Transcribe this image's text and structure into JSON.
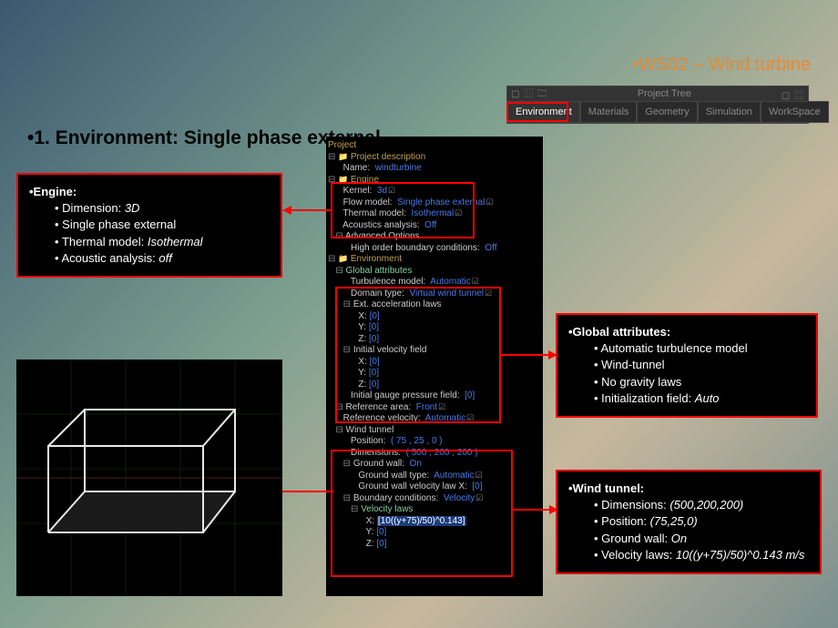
{
  "slide_title": "•WS02 – Wind turbine",
  "section_heading": "•1. Environment: Single phase external",
  "project_tree_panel": {
    "title": "Project Tree",
    "left_icons": "▢ ⿲ 🗀",
    "right_icons": "▢ ⿴",
    "tabs": [
      "Environment",
      "Materials",
      "Geometry",
      "Simulation",
      "WorkSpace"
    ],
    "active_tab": "Environment"
  },
  "tree": {
    "project": "Project",
    "project_desc": "Project description",
    "name_l": "Name:",
    "name_v": "windturbine",
    "engine": "Engine",
    "kernel_l": "Kernel:",
    "kernel_v": "3d",
    "flow_l": "Flow model:",
    "flow_v": "Single phase external",
    "thermal_l": "Thermal model:",
    "thermal_v": "Isothermal",
    "acou_l": "Acoustics analysis:",
    "acou_v": "Off",
    "adv": "Advanced Options",
    "hobc_l": "High order boundary conditions:",
    "hobc_v": "Off",
    "env": "Environment",
    "glob": "Global attributes",
    "turb_l": "Turbulence model:",
    "turb_v": "Automatic",
    "dom_l": "Domain type:",
    "dom_v": "Virtual wind tunnel",
    "extacc": "Ext. acceleration laws",
    "x_l": "X:",
    "x_v": "[0]",
    "y_l": "Y:",
    "y_v": "[0]",
    "z_l": "Z:",
    "z_v": "[0]",
    "ivf": "Initial velocity field",
    "igp_l": "Initial gauge pressure field:",
    "igp_v": "[0]",
    "refa_l": "Reference area:",
    "refa_v": "Front",
    "refv_l": "Reference velocity:",
    "refv_v": "Automatic",
    "wt": "Wind tunnel",
    "pos_l": "Position:",
    "pos_v": "( 75 , 25 , 0 )",
    "dim_l": "Dimensions:",
    "dim_v": "( 500 , 200 , 200 )",
    "gw_l": "Ground wall:",
    "gw_v": "On",
    "gwt_l": "Ground wall type:",
    "gwt_v": "Automatic",
    "gwvx_l": "Ground wall velocity law X:",
    "gwvx_v": "[0]",
    "bc_l": "Boundary conditions:",
    "bc_v": "Velocity",
    "vlaws": "Velocity laws",
    "vlx_v": "[10((y+75)/50)^0.143]"
  },
  "callouts": {
    "engine": {
      "title": "•Engine:",
      "items": [
        "Dimension: <em>3D</em>",
        "Single phase external",
        "Thermal model: <em>Isothermal</em>",
        "Acoustic analysis: <em>off</em>"
      ]
    },
    "global": {
      "title": "•Global attributes:",
      "items": [
        "Automatic turbulence model",
        "Wind-tunnel",
        "No gravity laws",
        "Initialization field: <em>Auto</em>"
      ]
    },
    "wind": {
      "title": "•Wind tunnel:",
      "items": [
        "Dimensions: <em>(500,200,200)</em>",
        "Position: <em>(75,25,0)</em>",
        "Ground wall: <em>On</em>",
        "Velocity laws: <em>10((y+75)/50)^0.143 m/s</em>"
      ]
    }
  }
}
